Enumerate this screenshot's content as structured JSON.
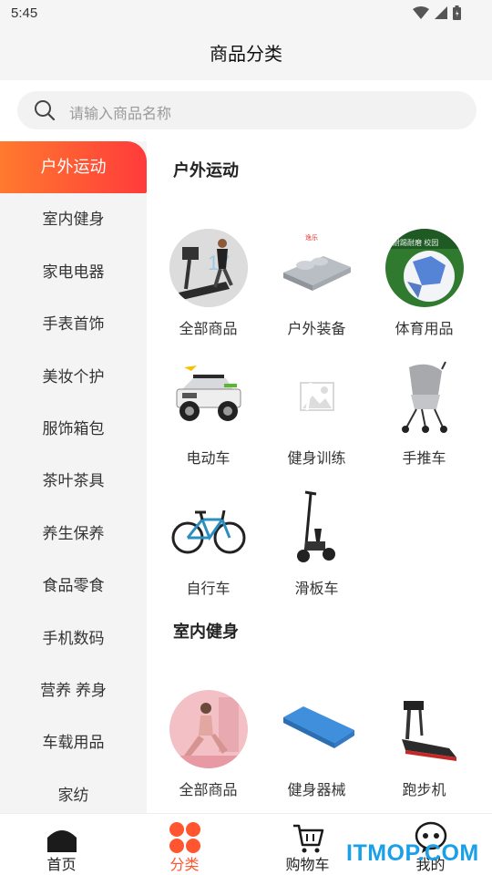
{
  "status_bar": {
    "time": "5:45"
  },
  "header": {
    "title": "商品分类"
  },
  "search": {
    "placeholder": "请输入商品名称"
  },
  "sidebar": {
    "items": [
      {
        "label": "户外运动",
        "active": true
      },
      {
        "label": "室内健身"
      },
      {
        "label": "家电电器"
      },
      {
        "label": "手表首饰"
      },
      {
        "label": "美妆个护"
      },
      {
        "label": "服饰箱包"
      },
      {
        "label": "茶叶茶具"
      },
      {
        "label": "养生保养"
      },
      {
        "label": "食品零食"
      },
      {
        "label": "手机数码"
      },
      {
        "label": "营养 养身"
      },
      {
        "label": "车载用品"
      },
      {
        "label": "家纺"
      }
    ]
  },
  "sections": [
    {
      "title": "户外运动",
      "items": [
        {
          "label": "全部商品",
          "icon": "treadmill-image"
        },
        {
          "label": "户外装备",
          "icon": "air-mattress-image"
        },
        {
          "label": "体育用品",
          "icon": "soccer-ball-image"
        },
        {
          "label": "电动车",
          "icon": "toy-jeep-image"
        },
        {
          "label": "健身训练",
          "icon": "image-placeholder-icon"
        },
        {
          "label": "手推车",
          "icon": "stroller-image"
        },
        {
          "label": "自行车",
          "icon": "bicycle-image"
        },
        {
          "label": "滑板车",
          "icon": "scooter-image"
        }
      ]
    },
    {
      "title": "室内健身",
      "items": [
        {
          "label": "全部商品",
          "icon": "yoga-image"
        },
        {
          "label": "健身器械",
          "icon": "yoga-mat-image"
        },
        {
          "label": "跑步机",
          "icon": "treadmill-image"
        }
      ]
    }
  ],
  "tabbar": {
    "items": [
      {
        "label": "首页",
        "icon": "home-icon"
      },
      {
        "label": "分类",
        "icon": "category-icon",
        "active": true
      },
      {
        "label": "购物车",
        "icon": "cart-icon"
      },
      {
        "label": "我的",
        "icon": "profile-chat-icon"
      }
    ]
  },
  "watermark": {
    "text": "ITMOP.COM"
  },
  "colors": {
    "accent": "#ff4a36",
    "accent_start": "#ff7a2e",
    "sidebar_bg": "#f4f4f4",
    "watermark": "#1aa0e8"
  }
}
